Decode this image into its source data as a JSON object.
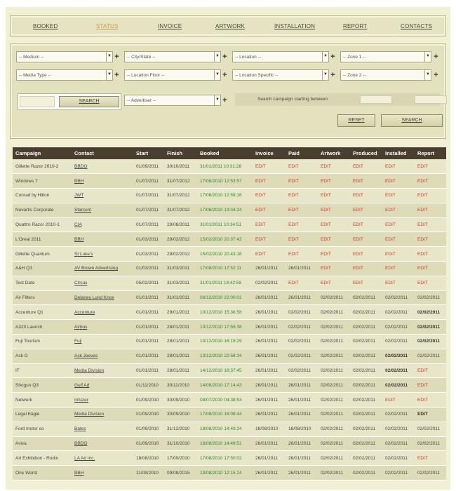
{
  "nav": [
    {
      "label": "BOOKED",
      "active": false
    },
    {
      "label": "STATUS",
      "active": true
    },
    {
      "label": "INVOICE",
      "active": false
    },
    {
      "label": "ARTWORK",
      "active": false
    },
    {
      "label": "INSTALLATION",
      "active": false
    },
    {
      "label": "REPORT",
      "active": false
    },
    {
      "label": "CONTACTS",
      "active": false
    }
  ],
  "filters": {
    "medium": "-- Medium --",
    "city_state": "-- City/State --",
    "location": "-- Location --",
    "zone1": "-- Zone 1 --",
    "media_type": "-- Media Type --",
    "location_floor": "-- Location Floor --",
    "location_specific": "-- Location Specific --",
    "zone2": "-- Zone 2 --",
    "advertiser": "-- Advertiser --",
    "search_button": "SEARCH",
    "date_range_label": "Search campaign starting between",
    "reset_button": "RESET",
    "search_button_2": "SEARCH"
  },
  "table": {
    "columns": [
      "Campaign",
      "Contact",
      "Start",
      "Finish",
      "Booked",
      "Invoice",
      "Paid",
      "Artwork",
      "Produced",
      "Installed",
      "Report"
    ],
    "rows": [
      [
        "Gillette Razor 2010-2",
        "BBDO",
        "01/09/2011",
        "30/10/2011",
        "31/01/2011 10:31:28",
        "EDIT",
        "EDIT",
        "EDIT",
        "EDIT",
        "EDIT",
        "EDIT"
      ],
      [
        "Windows 7",
        "BBH",
        "01/07/2011",
        "31/07/2012",
        "17/06/2010 12:53:57",
        "EDIT",
        "EDIT",
        "EDIT",
        "EDIT",
        "EDIT",
        "EDIT"
      ],
      [
        "Conrad by Hilton",
        "JWT",
        "01/07/2011",
        "31/07/2012",
        "17/06/2010 12:59:16",
        "EDIT",
        "EDIT",
        "EDIT",
        "EDIT",
        "EDIT",
        "EDIT"
      ],
      [
        "Novartis Corporate",
        "Starcom",
        "01/07/2011",
        "31/07/2012",
        "17/06/2010 13:04:24",
        "EDIT",
        "EDIT",
        "EDIT",
        "EDIT",
        "EDIT",
        "EDIT"
      ],
      [
        "Quattro Razor 2010-1",
        "CIA",
        "01/07/2011",
        "29/08/2011",
        "31/01/2011 10:34:51",
        "EDIT",
        "EDIT",
        "EDIT",
        "EDIT",
        "EDIT",
        "EDIT"
      ],
      [
        "L'Oreal 2011",
        "BBH",
        "01/03/2011",
        "29/02/2012",
        "15/02/2010 20:37:42",
        "EDIT",
        "EDIT",
        "EDIT",
        "EDIT",
        "EDIT",
        "EDIT"
      ],
      [
        "Gillette Quantum",
        "St Luke's",
        "01/03/2011",
        "29/02/2012",
        "15/02/2010 20:43:18",
        "EDIT",
        "EDIT",
        "EDIT",
        "EDIT",
        "EDIT",
        "EDIT"
      ],
      [
        "A&H Q3",
        "AV Brown Advertising",
        "01/03/2011",
        "31/03/2011",
        "17/08/2010 17:52:11",
        "26/01/2011",
        "26/01/2011",
        "EDIT",
        "EDIT",
        "EDIT",
        "EDIT"
      ],
      [
        "Test Date",
        "Circus",
        "05/02/2011",
        "31/03/2011",
        "31/01/2011 18:42:59",
        "02/02/2011",
        "EDIT",
        "EDIT",
        "EDIT",
        "EDIT",
        "EDIT"
      ],
      [
        "Air Filters",
        "Delaney Lund Knox",
        "01/01/2011",
        "31/01/2011",
        "08/12/2010 22:00:01",
        "26/01/2011",
        "26/01/2011",
        "02/02/2011",
        "02/02/2011",
        "02/02/2011",
        "02/02/2011"
      ],
      [
        "Accenture Q1",
        "Accenture",
        "01/01/2011",
        "28/01/2011",
        "10/12/2010 15:36:58",
        "26/01/2011",
        "02/02/2011",
        "02/02/2011",
        "02/02/2011",
        "02/02/2011",
        "02/02/2011"
      ],
      [
        "A320 Launch",
        "Airbus",
        "01/01/2011",
        "28/01/2011",
        "10/12/2010 17:55:38",
        "26/01/2011",
        "02/02/2011",
        "02/02/2011",
        "02/02/2011",
        "02/02/2011",
        "02/02/2011"
      ],
      [
        "Fuji Tourism",
        "Fuji",
        "01/01/2011",
        "28/01/2011",
        "10/12/2010 16:19:29",
        "26/01/2011",
        "02/02/2011",
        "02/02/2011",
        "02/02/2011",
        "02/02/2011",
        "02/02/2011"
      ],
      [
        "Ask G",
        "Ask Jeeves",
        "01/01/2011",
        "28/01/2011",
        "13/12/2010 22:58:34",
        "26/01/2011",
        "02/02/2011",
        "02/02/2011",
        "02/02/2011",
        "02/02/2011",
        "02/02/2011"
      ],
      [
        "IT",
        "Media Division",
        "01/01/2011",
        "28/01/2011",
        "14/12/2010 18:37:45",
        "26/01/2011",
        "02/02/2011",
        "02/02/2011",
        "02/02/2011",
        "02/02/2011",
        "EDIT"
      ],
      [
        "Shogun Q3",
        "Gulf Ad",
        "01/11/2010",
        "30/11/2010",
        "14/09/2010 17:14:43",
        "26/01/2011",
        "26/01/2011",
        "02/02/2011",
        "02/02/2011",
        "02/02/2011",
        "EDIT"
      ],
      [
        "Network",
        "Infuzer",
        "01/09/2010",
        "30/09/2010",
        "08/07/2010 04:38:53",
        "26/01/2011",
        "26/01/2011",
        "02/02/2011",
        "02/02/2011",
        "EDIT",
        "EDIT"
      ],
      [
        "Legal Eagle",
        "Media Division",
        "01/09/2010",
        "30/09/2010",
        "17/08/2010 16:08:44",
        "26/01/2011",
        "26/01/2011",
        "02/02/2011",
        "02/02/2011",
        "02/02/2011",
        "EDIT"
      ],
      [
        "Ford motor co",
        "Bates",
        "01/09/2010",
        "31/12/2010",
        "18/08/2010 14:49:24",
        "18/08/2010",
        "18/08/2010",
        "02/02/2011",
        "02/02/2011",
        "02/02/2011",
        "02/02/2011"
      ],
      [
        "Aviva",
        "BBDO",
        "01/09/2010",
        "31/10/2010",
        "18/08/2010 14:49:51",
        "26/01/2011",
        "26/01/2011",
        "02/02/2011",
        "02/02/2011",
        "02/02/2011",
        "02/02/2011"
      ],
      [
        "Art Exhibition - Rodin",
        "LA Ad Inc.",
        "18/08/2010",
        "17/09/2010",
        "17/08/2010 17:50:02",
        "26/01/2011",
        "26/01/2011",
        "02/02/2011",
        "02/02/2011",
        "02/02/2011",
        "EDIT"
      ],
      [
        "One World",
        "BBH",
        "11/08/2010",
        "09/08/2015",
        "18/08/2010 12:15:24",
        "26/01/2011",
        "26/01/2011",
        "02/02/2011",
        "02/02/2011",
        "02/02/2011",
        "02/02/2011"
      ]
    ],
    "bold_cells": [
      [
        13,
        9
      ],
      [
        14,
        9
      ],
      [
        15,
        9
      ],
      [
        10,
        10
      ],
      [
        11,
        10
      ],
      [
        12,
        10
      ],
      [
        17,
        10
      ]
    ]
  },
  "colors": {
    "header_bg": "#4a3e2e",
    "booked_green": "#2a8a2a",
    "edit_red": "#d43a2a",
    "active_nav": "#c8a050"
  }
}
